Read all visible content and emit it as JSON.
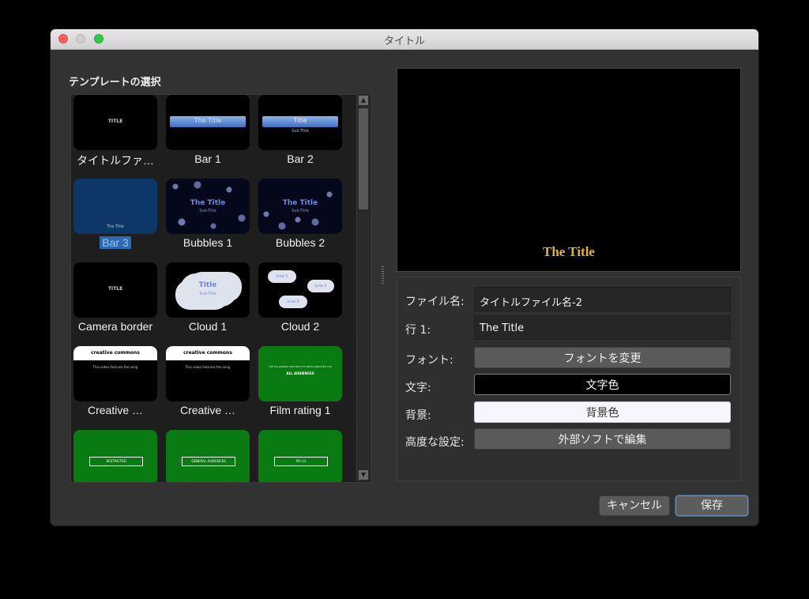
{
  "window": {
    "title": "タイトル"
  },
  "templates": {
    "heading": "テンプレートの選択",
    "items": [
      {
        "label": "タイトルファ…",
        "thumb_text": "TITLE",
        "selected": false
      },
      {
        "label": "Bar 1",
        "thumb_text": "The Title",
        "selected": false
      },
      {
        "label": "Bar 2",
        "thumb_text": "Title",
        "thumb_sub": "Sub-Title",
        "selected": false
      },
      {
        "label": "Bar 3",
        "thumb_text": "The Title",
        "selected": true
      },
      {
        "label": "Bubbles 1",
        "thumb_text": "The Title",
        "thumb_sub": "Sub-Title",
        "selected": false
      },
      {
        "label": "Bubbles 2",
        "thumb_text": "The Title",
        "thumb_sub": "Sub-Title",
        "selected": false
      },
      {
        "label": "Camera border",
        "thumb_text": "TITLE",
        "selected": false
      },
      {
        "label": "Cloud 1",
        "thumb_text": "Title",
        "thumb_sub": "Sub-Title",
        "selected": false
      },
      {
        "label": "Cloud 2",
        "thumb_text": "Line 1",
        "thumb_sub": "Line 2",
        "thumb_sub2": "Line 3",
        "selected": false
      },
      {
        "label": "Creative …",
        "thumb_text": "creative commons",
        "thumb_sub": "This video features the song",
        "selected": false
      },
      {
        "label": "Creative …",
        "thumb_text": "creative commons",
        "thumb_sub": "This video features the song",
        "selected": false
      },
      {
        "label": "Film rating 1",
        "thumb_text": "THE FOLLOWING PREVIEW HAS BEEN APPROVED FOR",
        "thumb_sub": "ALL AUDIENCES",
        "selected": false
      },
      {
        "label": "",
        "thumb_text": "RESTRICTED",
        "selected": false
      },
      {
        "label": "",
        "thumb_text": "GENERAL AUDIENCES",
        "selected": false
      },
      {
        "label": "",
        "thumb_text": "PG-13",
        "selected": false
      }
    ]
  },
  "preview": {
    "text": "The Title"
  },
  "form": {
    "filename_label": "ファイル名:",
    "filename_value": "タイトルファイル名-2",
    "line1_label": "行 1:",
    "line1_value": "The Title",
    "font_label": "フォント:",
    "font_button": "フォントを変更",
    "text_color_label": "文字:",
    "text_color_button": "文字色",
    "bg_label": "背景:",
    "bg_button": "背景色",
    "advanced_label": "高度な設定:",
    "advanced_button": "外部ソフトで編集"
  },
  "buttons": {
    "cancel": "キャンセル",
    "save": "保存"
  },
  "colors": {
    "selection": "#2c6bb1",
    "preview_text": "#e4b13c",
    "film_green": "#0a7a12"
  }
}
